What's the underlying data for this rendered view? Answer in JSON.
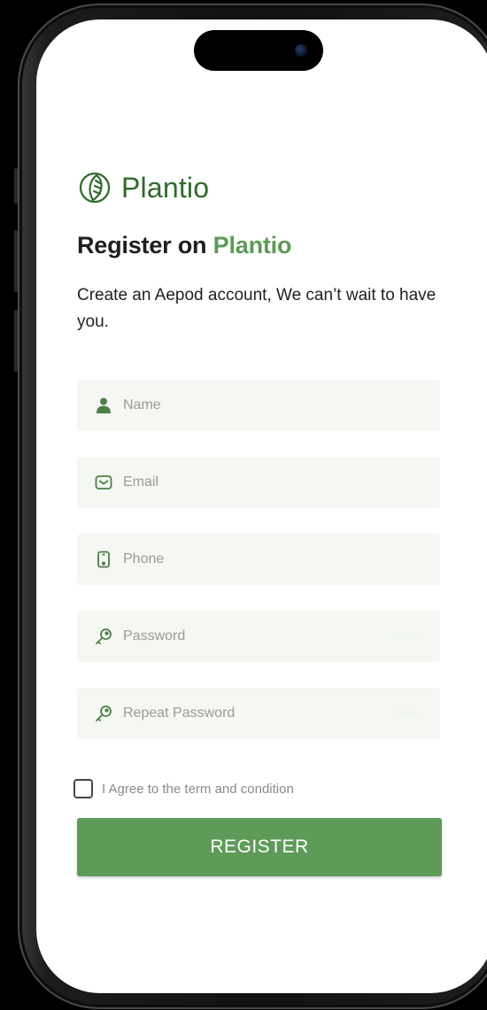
{
  "brand": {
    "name": "Plantio",
    "color": "#2e6b2a"
  },
  "heading": {
    "prefix": "Register on ",
    "accent": "Plantio",
    "accent_color": "#5e9a58"
  },
  "subtitle": "Create an Aepod account, We can’t wait to have you.",
  "fields": {
    "name": {
      "placeholder": "Name",
      "icon": "user-icon"
    },
    "email": {
      "placeholder": "Email",
      "icon": "mail-icon"
    },
    "phone": {
      "placeholder": "Phone",
      "icon": "phone-icon"
    },
    "password": {
      "placeholder": "Password",
      "icon": "key-icon",
      "toggle_label": "Show"
    },
    "repeat_password": {
      "placeholder": "Repeat Password",
      "icon": "key-icon",
      "toggle_label": "Show"
    }
  },
  "agree": {
    "label": "I Agree to the term and condition",
    "checked": false
  },
  "register_button": {
    "label": "REGISTER",
    "color": "#5e9a58"
  }
}
